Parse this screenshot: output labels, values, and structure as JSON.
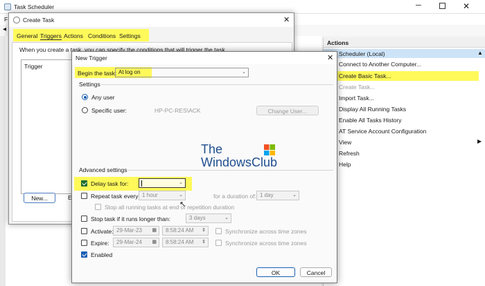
{
  "main_window": {
    "title": "Task Scheduler"
  },
  "actions_panel": {
    "header": "Actions",
    "section": "Scheduler (Local)",
    "items": [
      "Connect to Another Computer...",
      "Create Basic Task...",
      "Create Task...",
      "Import Task...",
      "Display All Running Tasks",
      "Enable All Tasks History",
      "AT Service Account Configuration",
      "View",
      "Refresh",
      "Help"
    ]
  },
  "create_task": {
    "title": "Create Task",
    "tabs": [
      "General",
      "Triggers",
      "Actions",
      "Conditions",
      "Settings"
    ],
    "description": "When you create a task, you can specify the conditions that will trigger the task.",
    "column_header": "Trigger",
    "new_button": "New..."
  },
  "new_trigger": {
    "title": "New Trigger",
    "begin_label": "Begin the task:",
    "begin_value": "At log on",
    "settings_label": "Settings",
    "any_user": "Any user",
    "specific_user": "Specific user:",
    "user_value": "HP-PC-RES\\ACK",
    "change_user": "Change User...",
    "advanced_label": "Advanced settings",
    "delay_label": "Delay task for:",
    "delay_value": "",
    "repeat_label": "Repeat task every:",
    "repeat_value": "1 hour",
    "duration_label": "for a duration of:",
    "duration_value": "1 day",
    "stop_running": "Stop all running tasks at end of repetition duration",
    "stop_longer": "Stop task if it runs longer than:",
    "stop_longer_value": "3 days",
    "activate_label": "Activate:",
    "activate_date": "29-Mar-23",
    "activate_time": "8:58:24 AM",
    "expire_label": "Expire:",
    "expire_date": "29-Mar-24",
    "expire_time": "8:58:24 AM",
    "sync_label": "Synchronize across time zones",
    "enabled_label": "Enabled",
    "ok": "OK",
    "cancel": "Cancel"
  },
  "watermark": {
    "line1": "The",
    "line2": "WindowsClub"
  },
  "colors": {
    "highlight": "#fff95a",
    "accent": "#1a5fb4",
    "selected_row": "#cde3f7"
  }
}
